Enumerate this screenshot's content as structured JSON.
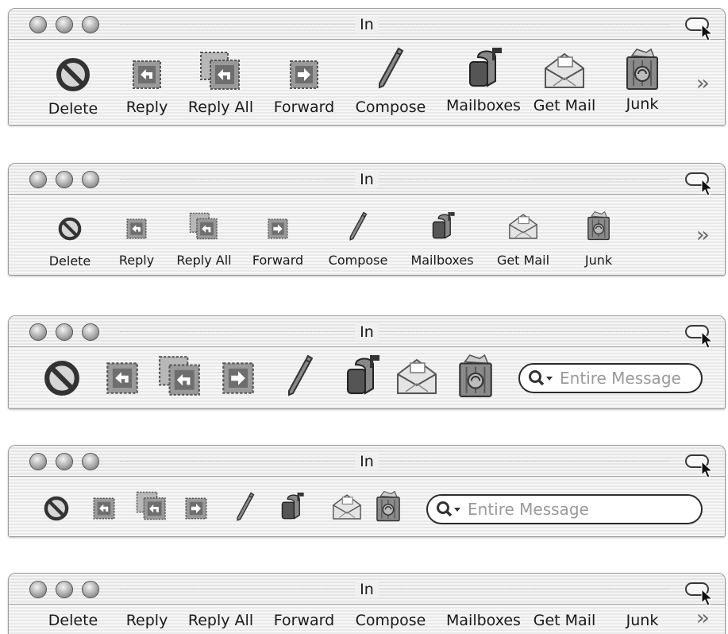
{
  "window": {
    "title": "In",
    "search_placeholder": "Entire Message"
  },
  "toolbar_items": [
    {
      "label": "Delete",
      "icon": "delete-icon"
    },
    {
      "label": "Reply",
      "icon": "reply-icon"
    },
    {
      "label": "Reply All",
      "icon": "reply-all-icon"
    },
    {
      "label": "Forward",
      "icon": "forward-icon"
    },
    {
      "label": "Compose",
      "icon": "compose-icon"
    },
    {
      "label": "Mailboxes",
      "icon": "mailboxes-icon"
    },
    {
      "label": "Get Mail",
      "icon": "get-mail-icon"
    },
    {
      "label": "Junk",
      "icon": "junk-icon"
    }
  ],
  "overflow_icon": "overflow-chevron-icon",
  "search_icon": "search-icon",
  "variants": [
    {
      "mode": "icon-and-text-large",
      "search_visible": false
    },
    {
      "mode": "icon-and-text-small",
      "search_visible": false
    },
    {
      "mode": "icon-only-large",
      "search_visible": true
    },
    {
      "mode": "icon-only-small",
      "search_visible": true
    },
    {
      "mode": "text-only",
      "search_visible": false
    }
  ]
}
